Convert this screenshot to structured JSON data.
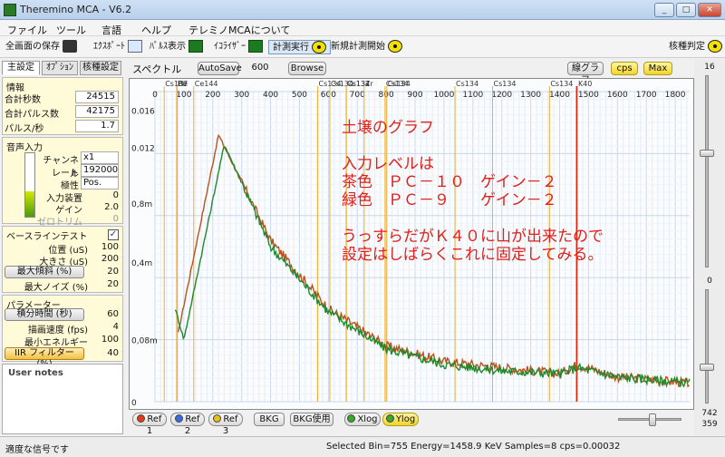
{
  "window": {
    "title": "Theremino MCA - V6.2",
    "minimize": "_",
    "maximize": "□",
    "close": "✕"
  },
  "menu": [
    "ファイル",
    "ツール",
    "言語",
    "ヘルプ",
    "テレミノMCAについて"
  ],
  "toolbar": {
    "save_screen": "全画面の保存",
    "export": "ｴｸｽﾎﾟｰﾄ",
    "pulse_display": "ﾊﾟﾙｽ表示",
    "equalizer": "ｲｺﾗｲｻﾞｰ",
    "measure_run": "計測実行",
    "new_measure": "新規計測開始",
    "nuclide_identify": "核種判定",
    "icons": {
      "camera": "camera-icon",
      "export": "floppy-icon",
      "wave": "waveform-icon",
      "radiation": "radiation-icon"
    }
  },
  "left_panel": {
    "tabs": [
      "主設定",
      "ｵﾌﾟｼｮﾝ",
      "核種設定"
    ],
    "info": {
      "title": "情報",
      "rows": [
        {
          "label": "合計秒数",
          "value": "24515"
        },
        {
          "label": "合計パルス数",
          "value": "42175"
        },
        {
          "label": "パルス/秒",
          "value": "1.7"
        }
      ]
    },
    "audio": {
      "title": "音声入力",
      "rows": [
        {
          "label": "チャンネル",
          "value": "x1"
        },
        {
          "label": "レート",
          "value": "192000"
        },
        {
          "label": "極性",
          "value": "Pos."
        },
        {
          "label": "入力装置",
          "value": "0"
        },
        {
          "label": "ゲイン",
          "value": "2.0"
        },
        {
          "label": "ゼロトリム",
          "value": "0"
        }
      ]
    },
    "baseline": {
      "title": "ベースラインテスト",
      "checked": "✓",
      "rows": [
        {
          "label": "位置 (uS)",
          "value": "100"
        },
        {
          "label": "大きさ (uS)",
          "value": "200"
        },
        {
          "label": "最大傾斜 (%)",
          "value": "20"
        },
        {
          "label": "最大ノイズ (%)",
          "value": "20"
        }
      ]
    },
    "params": {
      "title": "パラメーター",
      "rows": [
        {
          "label": "積分時間 (秒)",
          "value": "60"
        },
        {
          "label": "描画速度 (fps)",
          "value": "4"
        },
        {
          "label": "最小エネルギー",
          "value": "100"
        },
        {
          "label": "IIR フィルター (%)",
          "value": "40"
        }
      ]
    },
    "notes_title": "User notes"
  },
  "chart_header": {
    "spectrum_label": "スペクトル",
    "autosave": "AutoSave",
    "autosave_value": "600",
    "browse": "Browse",
    "line_graph": "線グラフ",
    "cps": "cps",
    "max": "Max"
  },
  "chart_data": {
    "type": "line",
    "x_ticks": [
      "0",
      "100",
      "200",
      "300",
      "400",
      "500",
      "600",
      "700",
      "800",
      "900",
      "1000",
      "1100",
      "1200",
      "1300",
      "1400",
      "1500",
      "1600",
      "1700",
      "1800"
    ],
    "y_ticks": [
      "0.016",
      "0.012",
      "0,8m",
      "0,4m",
      "0,08m",
      "0"
    ],
    "xlim": [
      0,
      1850
    ],
    "isotope_markers": [
      {
        "label": "Cs137",
        "x": 32
      },
      {
        "label": "Pb",
        "x": 75
      },
      {
        "label": "Be",
        "x": 77
      },
      {
        "label": "Ce144",
        "x": 134
      },
      {
        "label": "Cs134",
        "x": 563
      },
      {
        "label": "Cs134",
        "x": 605
      },
      {
        "label": "Cs134",
        "x": 662
      },
      {
        "label": "Cs137",
        "x": 662
      },
      {
        "label": "Zr",
        "x": 724
      },
      {
        "label": "Cs134",
        "x": 796
      },
      {
        "label": "Cs134",
        "x": 802
      },
      {
        "label": "Cs134",
        "x": 1038
      },
      {
        "label": "Cs134",
        "x": 1168
      },
      {
        "label": "Cs134",
        "x": 1365
      },
      {
        "label": "K40",
        "x": 1461
      }
    ],
    "cursor_x": 1459,
    "series": [
      {
        "name": "PC-10",
        "color": "#b8521a",
        "peak_x": 220,
        "peak_y": 0.86,
        "baseline": [
          [
            80,
            0.22
          ],
          [
            220,
            0.86
          ],
          [
            400,
            0.52
          ],
          [
            600,
            0.3
          ],
          [
            800,
            0.18
          ],
          [
            1000,
            0.13
          ],
          [
            1200,
            0.11
          ],
          [
            1400,
            0.09
          ],
          [
            1460,
            0.12
          ],
          [
            1600,
            0.08
          ],
          [
            1850,
            0.06
          ]
        ]
      },
      {
        "name": "PC-9",
        "color": "#1c8a2a",
        "peak_x": 240,
        "peak_y": 0.83,
        "baseline": [
          [
            70,
            0.3
          ],
          [
            100,
            0.2
          ],
          [
            240,
            0.83
          ],
          [
            400,
            0.5
          ],
          [
            600,
            0.29
          ],
          [
            800,
            0.17
          ],
          [
            1000,
            0.12
          ],
          [
            1200,
            0.1
          ],
          [
            1400,
            0.09
          ],
          [
            1460,
            0.11
          ],
          [
            1600,
            0.08
          ],
          [
            1850,
            0.06
          ]
        ]
      }
    ],
    "annotation": [
      "土壌のグラフ",
      "",
      "入力レベルは",
      "茶色　ＰＣ－１０　ゲイン－２",
      "緑色　ＰＣ－９　　ゲイン－２",
      "",
      "うっすらだがＫ４０に山が出来たので",
      "設定はしばらくこれに固定してみる。"
    ]
  },
  "bottom_buttons": [
    "Ref 1",
    "Ref 2",
    "Ref 3",
    "BKG",
    "BKG使用",
    "Xlog",
    "Ylog"
  ],
  "right_bar": {
    "top_value": "16",
    "mid_value": "0",
    "v1": "742",
    "v2": "359"
  },
  "status": {
    "left": "適度な信号です",
    "info": "Selected Bin=755  Energy=1458.9 KeV  Samples=8  cps=0.00032"
  }
}
